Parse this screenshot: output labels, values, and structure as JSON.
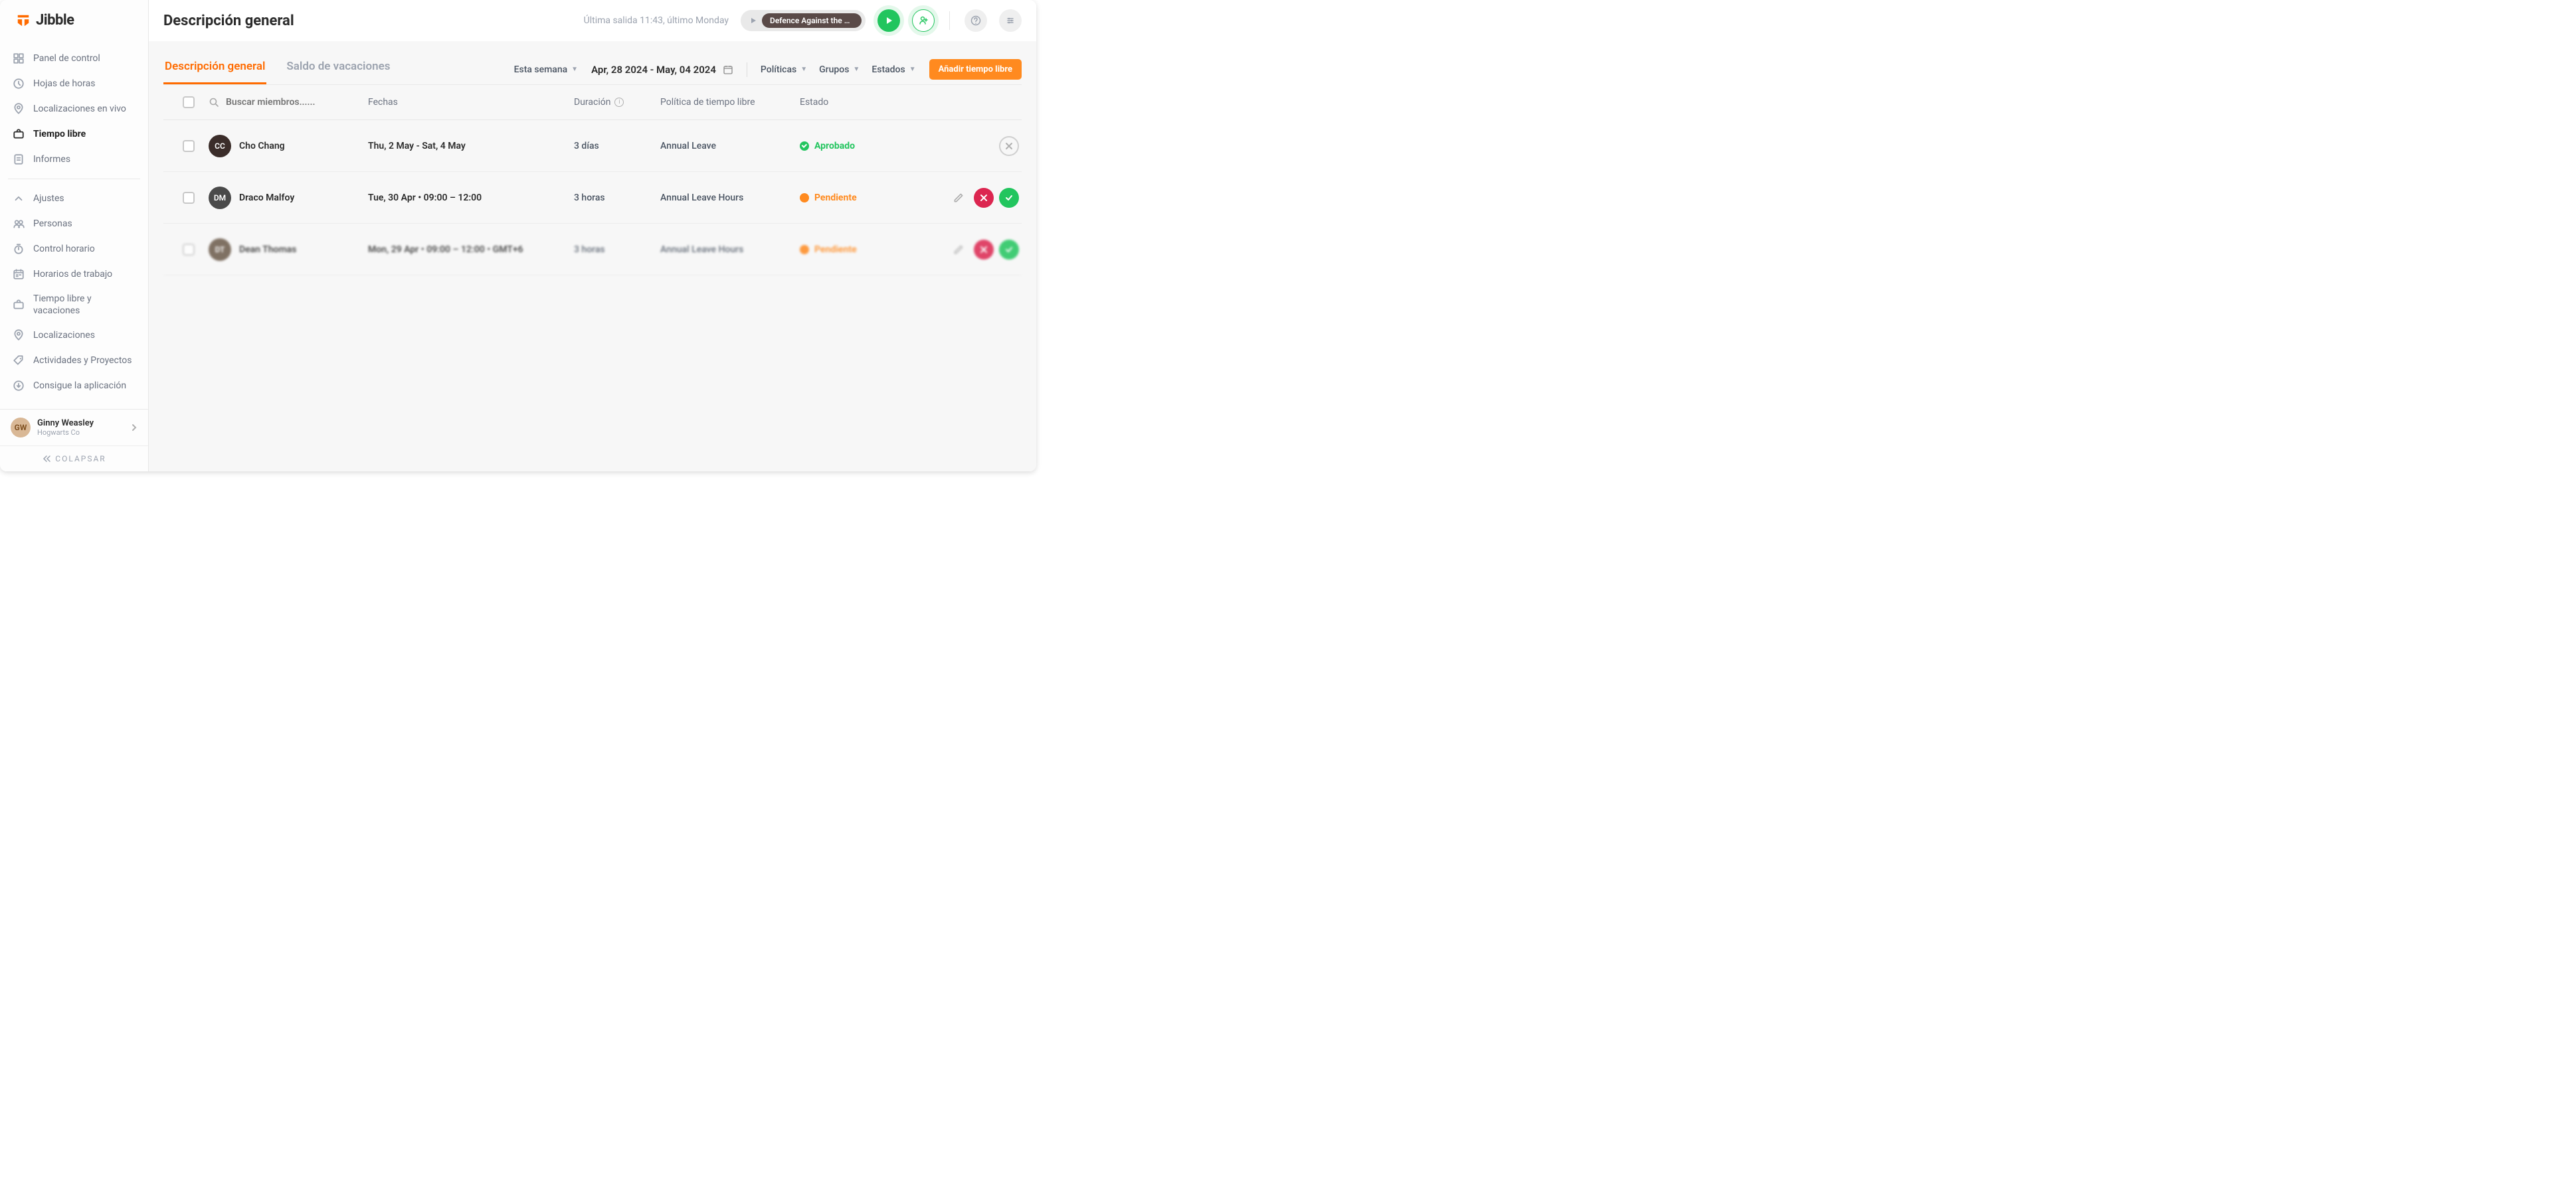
{
  "logo_text": "Jibble",
  "sidebar": {
    "nav_main": [
      {
        "label": "Panel de control",
        "icon": "dashboard"
      },
      {
        "label": "Hojas de horas",
        "icon": "clock"
      },
      {
        "label": "Localizaciones en vivo",
        "icon": "location"
      },
      {
        "label": "Tiempo libre",
        "icon": "suitcase",
        "active": true
      },
      {
        "label": "Informes",
        "icon": "report"
      }
    ],
    "nav_secondary": [
      {
        "label": "Ajustes",
        "icon": "chev-up"
      },
      {
        "label": "Personas",
        "icon": "people"
      },
      {
        "label": "Control horario",
        "icon": "timer"
      },
      {
        "label": "Horarios de trabajo",
        "icon": "schedule"
      },
      {
        "label": "Tiempo libre y vacaciones",
        "icon": "suitcase"
      },
      {
        "label": "Localizaciones",
        "icon": "location"
      },
      {
        "label": "Actividades y Proyectos",
        "icon": "tag"
      },
      {
        "label": "Consigue la aplicación",
        "icon": "download"
      }
    ],
    "user": {
      "name": "Ginny Weasley",
      "org": "Hogwarts Co"
    },
    "collapse": "COLAPSAR"
  },
  "topbar": {
    "title": "Descripción general",
    "last_out": "Última salida 11:43, último Monday",
    "chip": "Defence Against the Da..."
  },
  "toolbar": {
    "tabs": [
      {
        "label": "Descripción general",
        "active": true
      },
      {
        "label": "Saldo de vacaciones",
        "active": false
      }
    ],
    "period": "Esta semana",
    "date_range": "Apr, 28 2024 - May, 04 2024",
    "filters": [
      {
        "label": "Políticas"
      },
      {
        "label": "Grupos"
      },
      {
        "label": "Estados"
      }
    ],
    "add_btn": "Añadir tiempo libre",
    "search_placeholder": "Buscar miembros......"
  },
  "table": {
    "headers": {
      "dates": "Fechas",
      "duration": "Duración",
      "policy": "Política de tiempo libre",
      "status": "Estado"
    },
    "rows": [
      {
        "name": "Cho Chang",
        "avatar_bg": "#3b2d2a",
        "dates": "Thu, 2 May - Sat, 4 May",
        "duration": "3 días",
        "policy": "Annual Leave",
        "status": "Aprobado",
        "status_type": "approved",
        "actions": "cancel"
      },
      {
        "name": "Draco Malfoy",
        "avatar_bg": "#4a4a4a",
        "dates": "Tue, 30 Apr • 09:00 – 12:00",
        "duration": "3 horas",
        "policy": "Annual Leave Hours",
        "status": "Pendiente",
        "status_type": "pending",
        "actions": "review"
      },
      {
        "name": "Dean Thomas",
        "avatar_bg": "#6b5a4a",
        "dates": "Mon, 29 Apr • 09:00 – 12:00 • GMT+6",
        "duration": "3 horas",
        "policy": "Annual Leave Hours",
        "status": "Pendiente",
        "status_type": "pending",
        "actions": "review",
        "blur": true
      }
    ]
  }
}
